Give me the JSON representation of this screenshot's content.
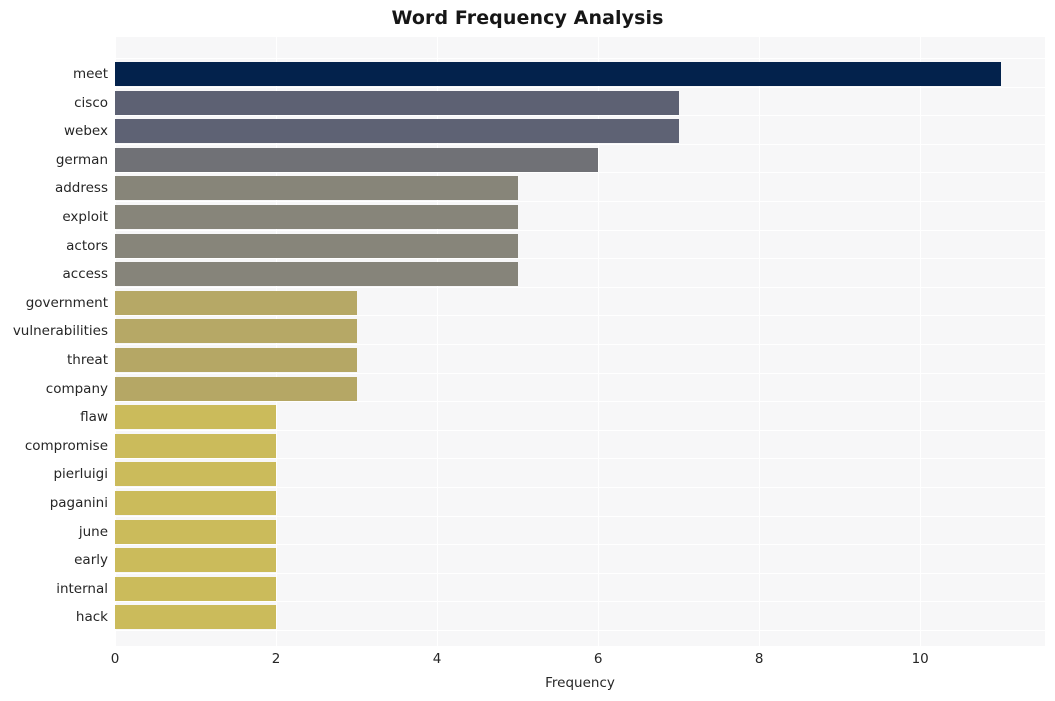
{
  "chart_data": {
    "type": "bar",
    "orientation": "horizontal",
    "title": "Word Frequency Analysis",
    "xlabel": "Frequency",
    "ylabel": "",
    "xlim": [
      0,
      11.55
    ],
    "xticks": [
      0,
      2,
      4,
      6,
      8,
      10
    ],
    "xtick_labels": [
      "0",
      "2",
      "4",
      "6",
      "8",
      "10"
    ],
    "grid": true,
    "legend": "none",
    "plot_background": "#f7f7f8",
    "gridline_color": "#ffffff",
    "categories": [
      "meet",
      "cisco",
      "webex",
      "german",
      "address",
      "exploit",
      "actors",
      "access",
      "government",
      "vulnerabilities",
      "threat",
      "company",
      "flaw",
      "compromise",
      "pierluigi",
      "paganini",
      "june",
      "early",
      "internal",
      "hack"
    ],
    "values": [
      11,
      7,
      7,
      6,
      5,
      5,
      5,
      5,
      3,
      3,
      3,
      3,
      2,
      2,
      2,
      2,
      2,
      2,
      2,
      2
    ],
    "bar_colors": [
      "#03224c",
      "#5d6173",
      "#5e6274",
      "#707176",
      "#878579",
      "#87857a",
      "#87857a",
      "#86847a",
      "#b6a866",
      "#b6a866",
      "#b5a765",
      "#b5a765",
      "#cbbb5b",
      "#cbbb5b",
      "#cbbb5b",
      "#cbbb5b",
      "#cbbb5b",
      "#cbbb5b",
      "#cbbb5b",
      "#cbbb5b"
    ]
  }
}
